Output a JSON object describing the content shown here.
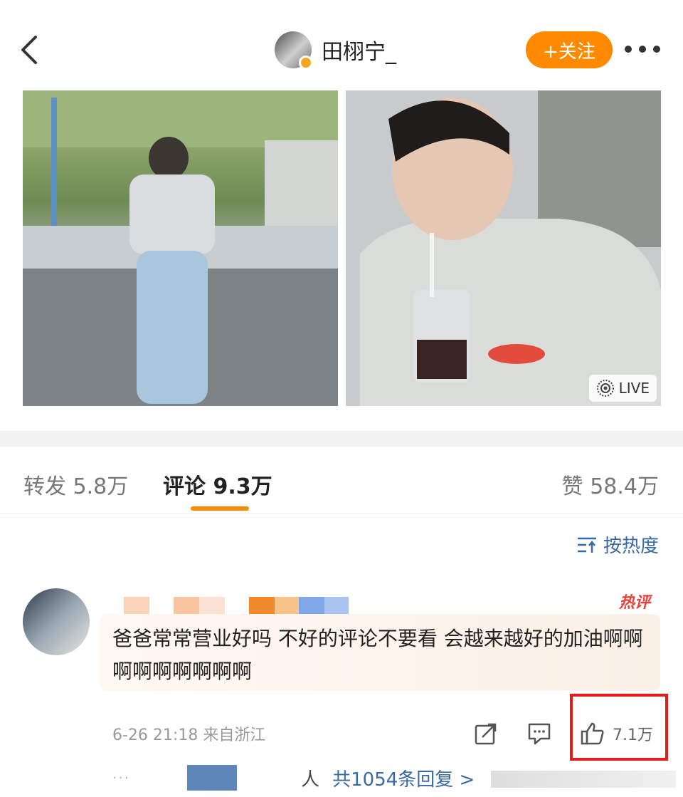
{
  "header": {
    "username": "田栩宁_",
    "follow_label": "+关注",
    "colors": {
      "follow_bg": "#ff8a00",
      "verified_badge": "#f5a623"
    }
  },
  "media": {
    "live_label": "LIVE"
  },
  "tabs": {
    "repost": "转发 5.8万",
    "comment": "评论 9.3万",
    "like": "赞 58.4万",
    "active_color": "#ff8a00"
  },
  "sort": {
    "label": "按热度",
    "icon": "sort-icon"
  },
  "comment": {
    "hot_tag": "热评",
    "text": "爸爸常常营业好吗 不好的评论不要看 会越来越好的加油啊啊啊啊啊啊啊啊啊",
    "meta": "6-26 21:18 来自浙江",
    "like_count": "7.1万",
    "icons": [
      "share-icon",
      "comment-icon",
      "thumbs-up-icon"
    ]
  },
  "replies": {
    "ren": "人",
    "link": "共1054条回复 >",
    "colors": {
      "link": "#3a6aa3"
    }
  },
  "annotation": {
    "highlight_color": "#e21b1b"
  }
}
